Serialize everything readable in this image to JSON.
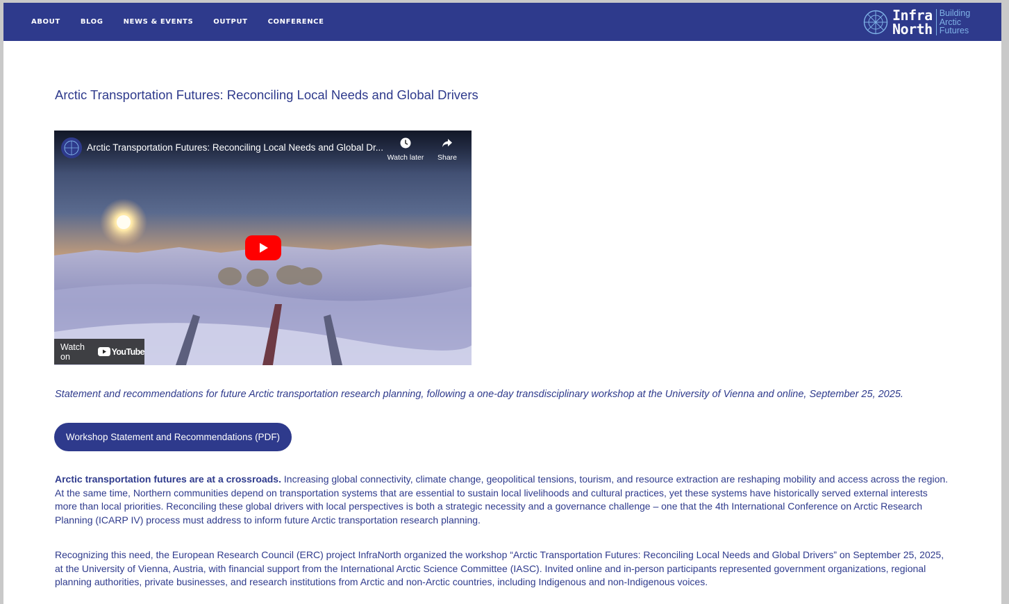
{
  "nav": {
    "items": [
      {
        "label": "ABOUT"
      },
      {
        "label": "BLOG"
      },
      {
        "label": "NEWS & EVENTS"
      },
      {
        "label": "OUTPUT"
      },
      {
        "label": "CONFERENCE"
      }
    ]
  },
  "logo": {
    "word_line1": "Infra",
    "word_line2": "North",
    "tagline": [
      "Building",
      "Arctic",
      "Futures"
    ]
  },
  "page": {
    "title": "Arctic Transportation Futures: Reconciling Local Needs and Global Drivers"
  },
  "video": {
    "title": "Arctic Transportation Futures: Reconciling Local Needs and Global Dr...",
    "watch_later_label": "Watch later",
    "share_label": "Share",
    "watch_on_label": "Watch on",
    "youtube_label": "YouTube",
    "icons": [
      "channel-avatar-icon",
      "clock-icon",
      "share-arrow-icon",
      "play-icon",
      "youtube-logo-icon"
    ]
  },
  "intro": "Statement and recommendations for future Arctic transportation research planning, following a one-day transdisciplinary workshop at the University of Vienna and online, September 25, 2025.",
  "pdf_button": {
    "label": "Workshop Statement and Recommendations (PDF)"
  },
  "paragraphs": [
    {
      "lead": "Arctic transportation futures are at a crossroads.",
      "text": " Increasing global connectivity, climate change, geopolitical tensions, tourism, and resource extraction are reshaping mobility and access across the region. At the same time, Northern communities depend on transportation systems that are essential to sustain local livelihoods and cultural practices, yet these systems have historically served external interests more than local priorities. Reconciling these global drivers with local perspectives is both a strategic necessity and a governance challenge – one that the 4th International Conference on Arctic Research Planning (ICARP IV) process must address to inform future Arctic transportation research planning."
    },
    {
      "text": "Recognizing this need, the European Research Council (ERC) project InfraNorth organized the workshop “Arctic Transportation Futures: Reconciling Local Needs and Global Drivers” on September 25, 2025, at the University of Vienna, Austria, with financial support from the International Arctic Science Committee (IASC). Invited online and in-person participants represented government organizations, regional planning authorities, private businesses, and research institutions from Arctic and non-Arctic countries, including Indigenous and non-Indigenous voices."
    }
  ],
  "colors": {
    "brand_navy": "#2e3a8c",
    "logo_accent": "#7fb2e6",
    "youtube_red": "#ff0000"
  }
}
